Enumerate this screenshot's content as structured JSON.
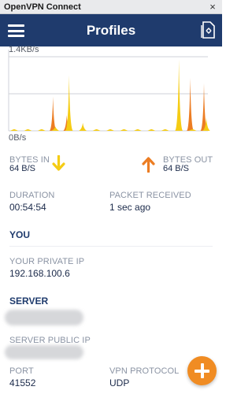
{
  "window": {
    "title": "OpenVPN Connect",
    "close_glyph": "×"
  },
  "header": {
    "title": "Profiles",
    "menu_icon": "hamburger-menu-icon",
    "import_icon": "import-profile-icon"
  },
  "chart_data": {
    "type": "area",
    "ylabel_top": "1.4KB/s",
    "ylabel_bottom": "0B/s",
    "ylim": [
      0,
      1.4
    ],
    "grid": true,
    "series": [
      {
        "color": "#f5cc14",
        "x": [
          0,
          1,
          2,
          3,
          4,
          5,
          6,
          7,
          8,
          9,
          10,
          11,
          12,
          13,
          14
        ],
        "values": [
          0.03,
          0.03,
          0.03,
          0.08,
          1.05,
          0.15,
          0.03,
          0.03,
          0.03,
          0.03,
          0.03,
          0.03,
          1.35,
          0.03,
          0.25
        ]
      },
      {
        "color": "#ec7d23",
        "x": [
          0,
          1,
          2,
          3,
          4,
          5,
          6,
          7,
          8,
          9,
          10,
          11,
          12,
          13,
          14
        ],
        "values": [
          0.0,
          0.0,
          0.0,
          0.65,
          0.3,
          0.0,
          0.0,
          0.0,
          0.0,
          0.0,
          0.0,
          0.0,
          0.0,
          1.0,
          0.9
        ]
      }
    ]
  },
  "stats": {
    "bytes_in_label": "BYTES IN",
    "bytes_in_value": "64 B/S",
    "bytes_out_label": "BYTES OUT",
    "bytes_out_value": "64 B/S",
    "in_arrow_color": "#f5cc14",
    "out_arrow_color": "#ec7d23"
  },
  "connection": {
    "duration_label": "DURATION",
    "duration_value": "00:54:54",
    "packet_label": "PACKET RECEIVED",
    "packet_value": "1 sec ago"
  },
  "you": {
    "section_title": "YOU",
    "private_ip_label": "YOUR PRIVATE IP",
    "private_ip_value": "192.168.100.6"
  },
  "server": {
    "section_title": "SERVER",
    "public_ip_label": "SERVER PUBLIC IP",
    "port_label": "PORT",
    "port_value": "41552",
    "protocol_label": "VPN PROTOCOL",
    "protocol_value": "UDP"
  },
  "fab": {
    "icon": "plus-icon",
    "color": "#f08c23"
  }
}
